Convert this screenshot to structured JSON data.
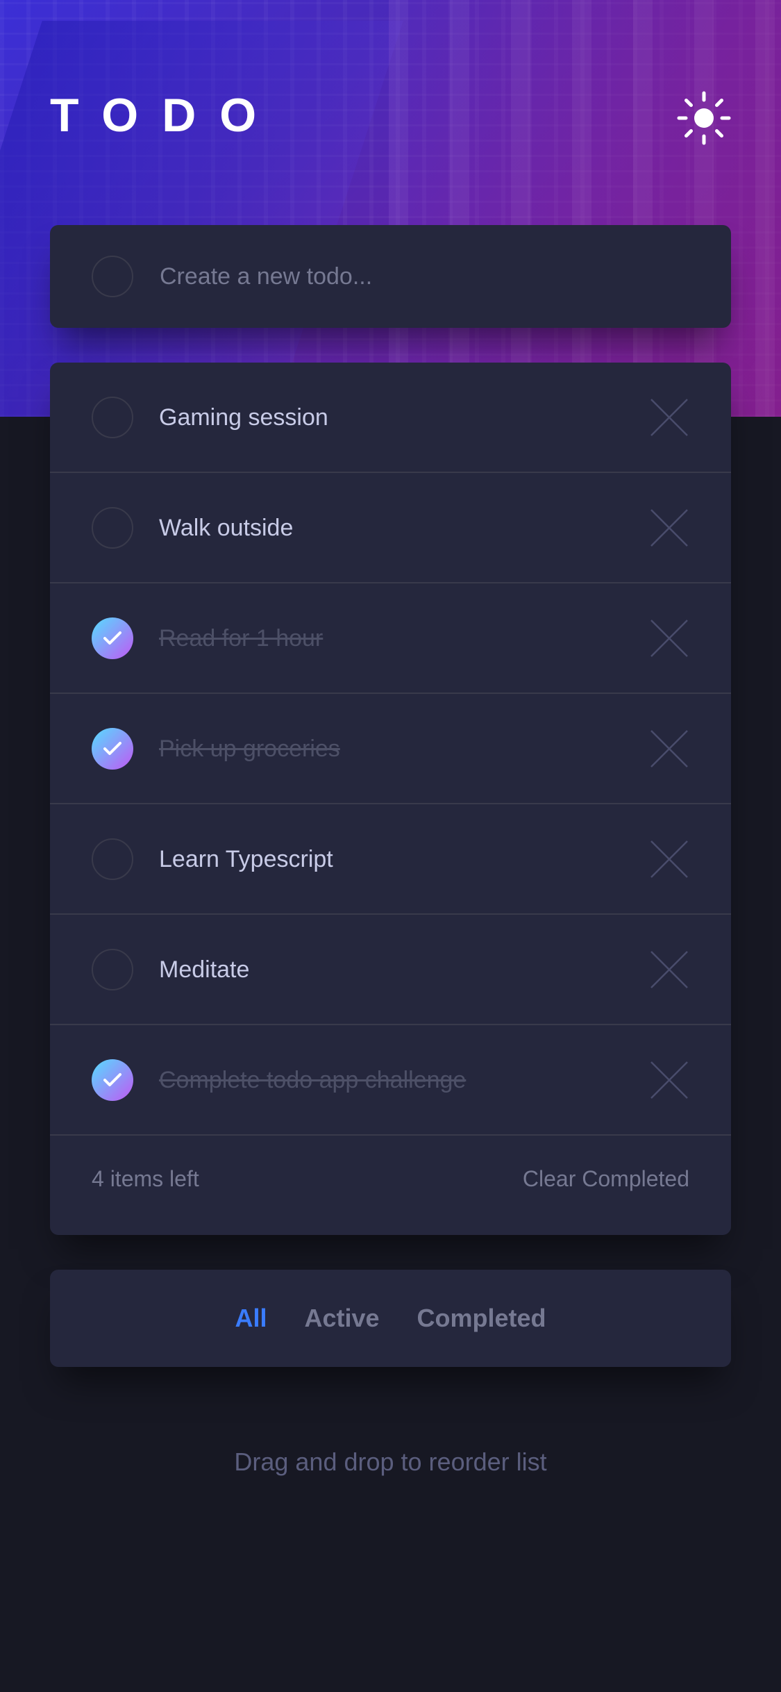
{
  "header": {
    "title": "TODO",
    "theme_icon": "sun-icon"
  },
  "new_todo": {
    "placeholder": "Create a new todo..."
  },
  "todos": [
    {
      "label": "Gaming session",
      "completed": false
    },
    {
      "label": "Walk outside",
      "completed": false
    },
    {
      "label": "Read for 1 hour",
      "completed": true
    },
    {
      "label": "Pick up groceries",
      "completed": true
    },
    {
      "label": "Learn Typescript",
      "completed": false
    },
    {
      "label": "Meditate",
      "completed": false
    },
    {
      "label": "Complete todo app challenge",
      "completed": true
    }
  ],
  "footer": {
    "items_left": "4 items left",
    "clear_label": "Clear Completed"
  },
  "filters": {
    "all": "All",
    "active": "Active",
    "completed": "Completed",
    "selected": "All"
  },
  "hint": "Drag and drop to reorder list",
  "colors": {
    "background": "#171823",
    "card": "#25273d",
    "accent": "#3a7cfd",
    "check_gradient_start": "#55ddff",
    "check_gradient_end": "#c058f3"
  }
}
